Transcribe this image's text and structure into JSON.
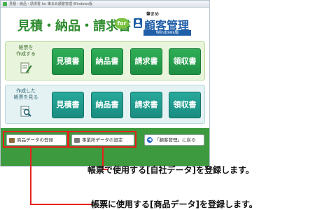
{
  "window": {
    "title": "見積・納品・請求書 for 筆まめ顧客管理 Windows版"
  },
  "header": {
    "main_title": "見積・納品・請求書",
    "for_label": "for",
    "brand_small": "筆まめ",
    "brand_main": "顧客管理",
    "brand_edition": "Windows版"
  },
  "panels": [
    {
      "label": "帳票を\n作成する",
      "icon": "pencil-document-icon",
      "buttons": [
        "見積書",
        "納品書",
        "請求書",
        "領収書"
      ]
    },
    {
      "label": "作成した\n帳票を見る",
      "icon": "magnifier-document-icon",
      "buttons": [
        "見積書",
        "納品書",
        "請求書",
        "領収書"
      ]
    }
  ],
  "footer": {
    "product_data_label": "商品データの登録",
    "office_data_label": "事業所データの設定",
    "back_label": "「顧客管理」に戻る"
  },
  "callouts": {
    "office": "帳票で使用する[自社データ]を登録します。",
    "product": "帳票に使用する[商品データ]を登録します。"
  },
  "colors": {
    "create_button": "#1e8f44",
    "view_button": "#198c80",
    "footer_bg": "#3e9a3e",
    "highlight": "#e8201c",
    "brand_blue": "#1f5fa8"
  }
}
